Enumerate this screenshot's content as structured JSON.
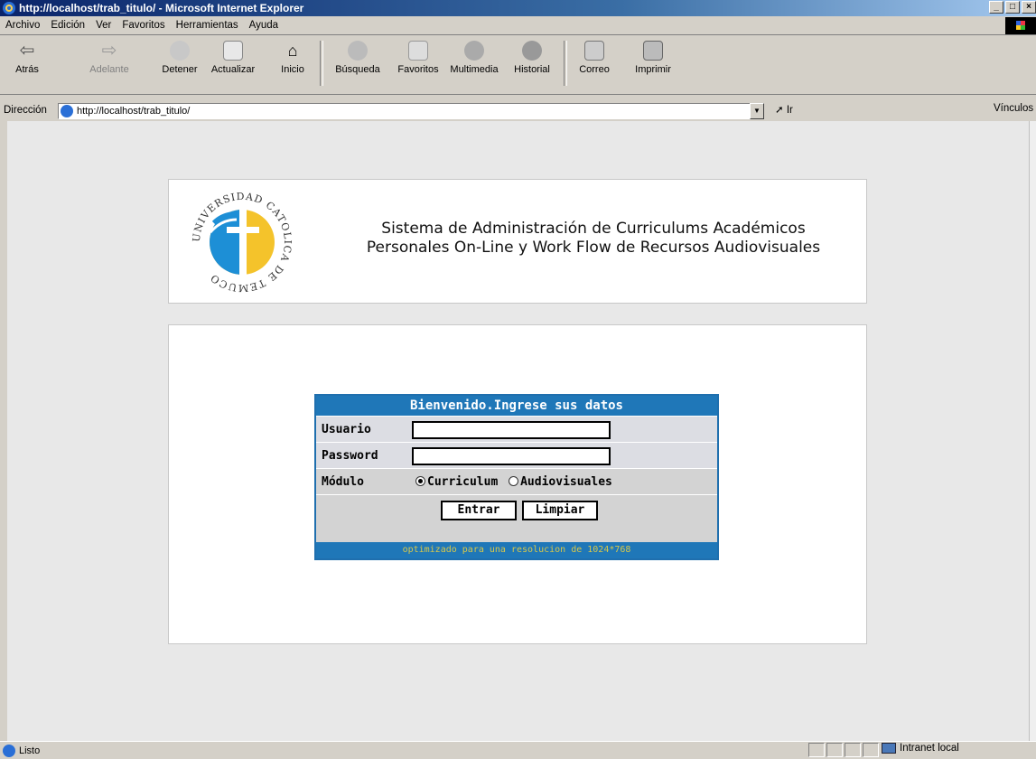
{
  "window": {
    "title": "http://localhost/trab_titulo/ - Microsoft Internet Explorer"
  },
  "menu": [
    "Archivo",
    "Edición",
    "Ver",
    "Favoritos",
    "Herramientas",
    "Ayuda"
  ],
  "toolbar": {
    "back": "Atrás",
    "forward": "Adelante",
    "stop": "Detener",
    "refresh": "Actualizar",
    "home": "Inicio",
    "search": "Búsqueda",
    "favorites": "Favoritos",
    "multimedia": "Multimedia",
    "history": "Historial",
    "mail": "Correo",
    "print": "Imprimir"
  },
  "address": {
    "label": "Dirección",
    "url": "http://localhost/trab_titulo/",
    "go": "Ir",
    "links": "Vínculos"
  },
  "header": {
    "title_line1": "Sistema de Administración de Curriculums Académicos",
    "title_line2": "Personales On-Line y Work Flow de Recursos Audiovisuales",
    "logo_text": "UNIVERSIDAD CATOLICA DE TEMUCO"
  },
  "login": {
    "heading": "Bienvenido.Ingrese sus datos",
    "user_label": "Usuario",
    "user_value": "",
    "password_label": "Password",
    "password_value": "",
    "module_label": "Módulo",
    "option_curriculum": "Curriculum",
    "option_audiovisuales": "Audiovisuales",
    "selected_module": "Curriculum",
    "submit": "Entrar",
    "clear": "Limpiar",
    "footer": "optimizado para una resolucion de 1024*768"
  },
  "status": {
    "text": "Listo",
    "zone": "Intranet local"
  },
  "colors": {
    "titlebar": "#0a246a",
    "panel_header": "#1f77b8",
    "footer_text": "#d8c84a"
  }
}
